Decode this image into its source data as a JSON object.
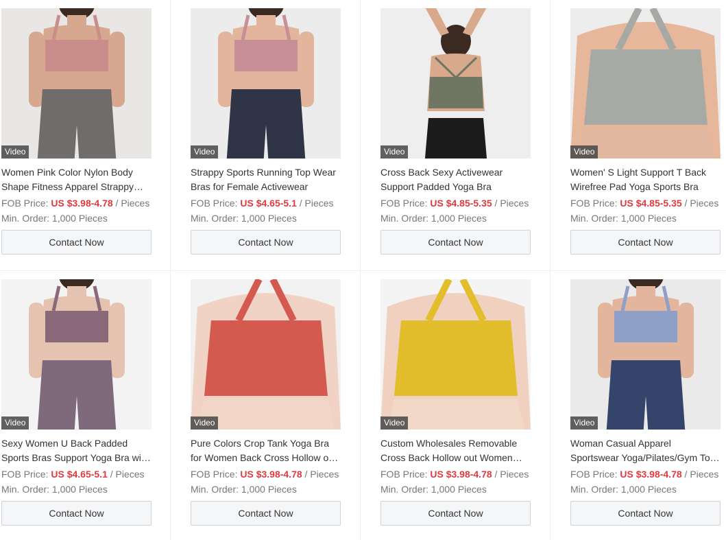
{
  "products": [
    {
      "title": "Women Pink Color Nylon Body Shape Fitness Apparel Strappy Back Sports Bra",
      "fob_label": "FOB Price:",
      "price": "US $3.98-4.78",
      "unit": "/ Pieces",
      "min_order": "Min. Order: 1,000 Pieces",
      "video": "Video",
      "contact": "Contact Now",
      "bg": "#e9e7e6",
      "top": "#c98d8a",
      "bottom": "#6f6c6b",
      "skin": "#d7a890",
      "view": "back"
    },
    {
      "title": "Strappy Sports Running Top Wear Bras for Female Activewear",
      "fob_label": "FOB Price:",
      "price": "US $4.65-5.1",
      "unit": "/ Pieces",
      "min_order": "Min. Order: 1,000 Pieces",
      "video": "Video",
      "contact": "Contact Now",
      "bg": "#ececec",
      "top": "#c98f96",
      "bottom": "#2f3447",
      "skin": "#e2b59c",
      "view": "front"
    },
    {
      "title": "Cross Back Sexy Activewear Support Padded Yoga Bra",
      "fob_label": "FOB Price:",
      "price": "US $4.85-5.35",
      "unit": "/ Pieces",
      "min_order": "Min. Order: 1,000 Pieces",
      "video": "Video",
      "contact": "Contact Now",
      "bg": "#eeeeee",
      "top": "#6f7664",
      "bottom": "#1c1c1c",
      "skin": "#d9a98c",
      "view": "back-arms"
    },
    {
      "title": "Women' S Light Support T Back Wirefree Pad Yoga Sports Bra",
      "fob_label": "FOB Price:",
      "price": "US $4.85-5.35",
      "unit": "/ Pieces",
      "min_order": "Min. Order: 1,000 Pieces",
      "video": "Video",
      "contact": "Contact Now",
      "bg": "#ededed",
      "top": "#a7a9a5",
      "bottom": "#e2b7a0",
      "skin": "#e6b79b",
      "view": "back-close"
    },
    {
      "title": "Sexy Women U Back Padded Sports Bras Support Yoga Bra with Removable Pads",
      "fob_label": "FOB Price:",
      "price": "US $4.65-5.1",
      "unit": "/ Pieces",
      "min_order": "Min. Order: 1,000 Pieces",
      "video": "Video",
      "contact": "Contact Now",
      "bg": "#f3f3f3",
      "top": "#8a6a7a",
      "bottom": "#7e6a7c",
      "skin": "#e6c2b1",
      "view": "back"
    },
    {
      "title": "Pure Colors Crop Tank Yoga Bra for Women Back Cross Hollow out Design",
      "fob_label": "FOB Price:",
      "price": "US $3.98-4.78",
      "unit": "/ Pieces",
      "min_order": "Min. Order: 1,000 Pieces",
      "video": "Video",
      "contact": "Contact Now",
      "bg": "#f2f2f2",
      "top": "#d45a4f",
      "bottom": "#f2d6c8",
      "skin": "#f0d3c4",
      "view": "back-close"
    },
    {
      "title": "Custom Wholesales Removable Cross Back Hollow out Women Yoga Bra",
      "fob_label": "FOB Price:",
      "price": "US $3.98-4.78",
      "unit": "/ Pieces",
      "min_order": "Min. Order: 1,000 Pieces",
      "video": "Video",
      "contact": "Contact Now",
      "bg": "#f4f4f4",
      "top": "#e2bd2c",
      "bottom": "#f2d8c6",
      "skin": "#f0d1bf",
      "view": "front-close"
    },
    {
      "title": "Woman Casual Apparel Sportswear Yoga/Pilates/Gym Top Backless Sports Bra",
      "fob_label": "FOB Price:",
      "price": "US $3.98-4.78",
      "unit": "/ Pieces",
      "min_order": "Min. Order: 1,000 Pieces",
      "video": "Video",
      "contact": "Contact Now",
      "bg": "#eaeaea",
      "top": "#8ea0c8",
      "bottom": "#34446a",
      "skin": "#e2b59c",
      "view": "front"
    }
  ]
}
